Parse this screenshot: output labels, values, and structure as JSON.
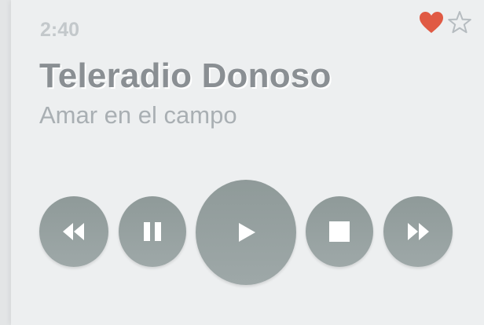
{
  "player": {
    "elapsed": "2:40",
    "station": "Teleradio Donoso",
    "track": "Amar en el campo"
  },
  "icons": {
    "favorite": "heart-icon",
    "star": "star-icon",
    "rewind": "rewind-icon",
    "pause": "pause-icon",
    "play": "play-icon",
    "stop": "stop-icon",
    "fast_forward": "fast-forward-icon"
  },
  "colors": {
    "heart": "#e05a44",
    "button": "#95a0a0",
    "icon": "#ffffff",
    "title": "#8a8f93",
    "subtitle": "#a9afb3",
    "time": "#c3c8cb"
  }
}
